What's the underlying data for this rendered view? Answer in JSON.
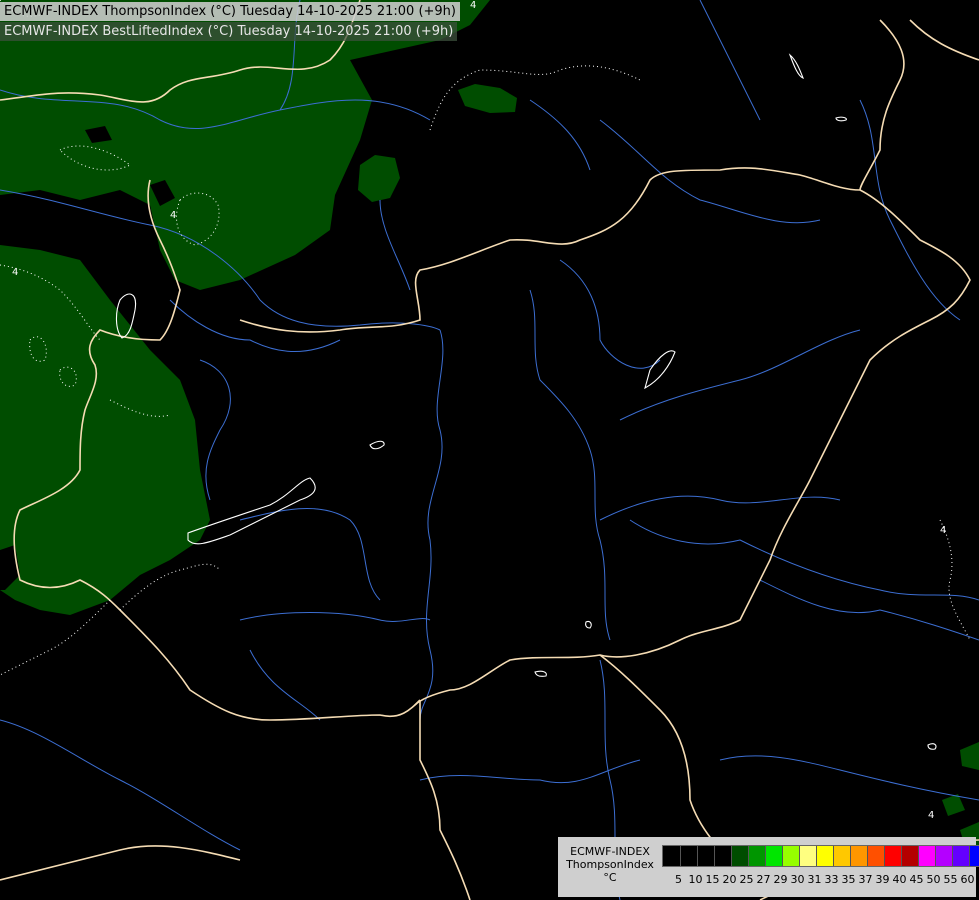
{
  "titles": {
    "line1": "ECMWF-INDEX ThompsonIndex (°C) Tuesday 14-10-2025 21:00 (+9h)",
    "line2": "ECMWF-INDEX BestLiftedIndex (°C) Tuesday 14-10-2025 21:00 (+9h)"
  },
  "contour_labels": [
    "4",
    "4",
    "4",
    "4",
    "4"
  ],
  "legend": {
    "model": "ECMWF-INDEX",
    "parameter": "ThompsonIndex",
    "unit": "°C",
    "ticks": [
      "5",
      "10",
      "15",
      "20",
      "25",
      "27",
      "29",
      "30",
      "31",
      "33",
      "35",
      "37",
      "39",
      "40",
      "45",
      "50",
      "55",
      "60"
    ],
    "colors": [
      "#000000",
      "#000000",
      "#000000",
      "#000000",
      "#004d00",
      "#009600",
      "#00e600",
      "#96ff00",
      "#ffff80",
      "#ffff00",
      "#ffc800",
      "#ff9600",
      "#ff5000",
      "#ff0000",
      "#b40000",
      "#ff00ff",
      "#b400ff",
      "#6400ff",
      "#0000ff"
    ]
  },
  "colors": {
    "background": "#000000",
    "green_area": "#004d00",
    "borders": "#f5dcb4",
    "rivers": "#3c6ed2",
    "contours": "#ffffff"
  }
}
